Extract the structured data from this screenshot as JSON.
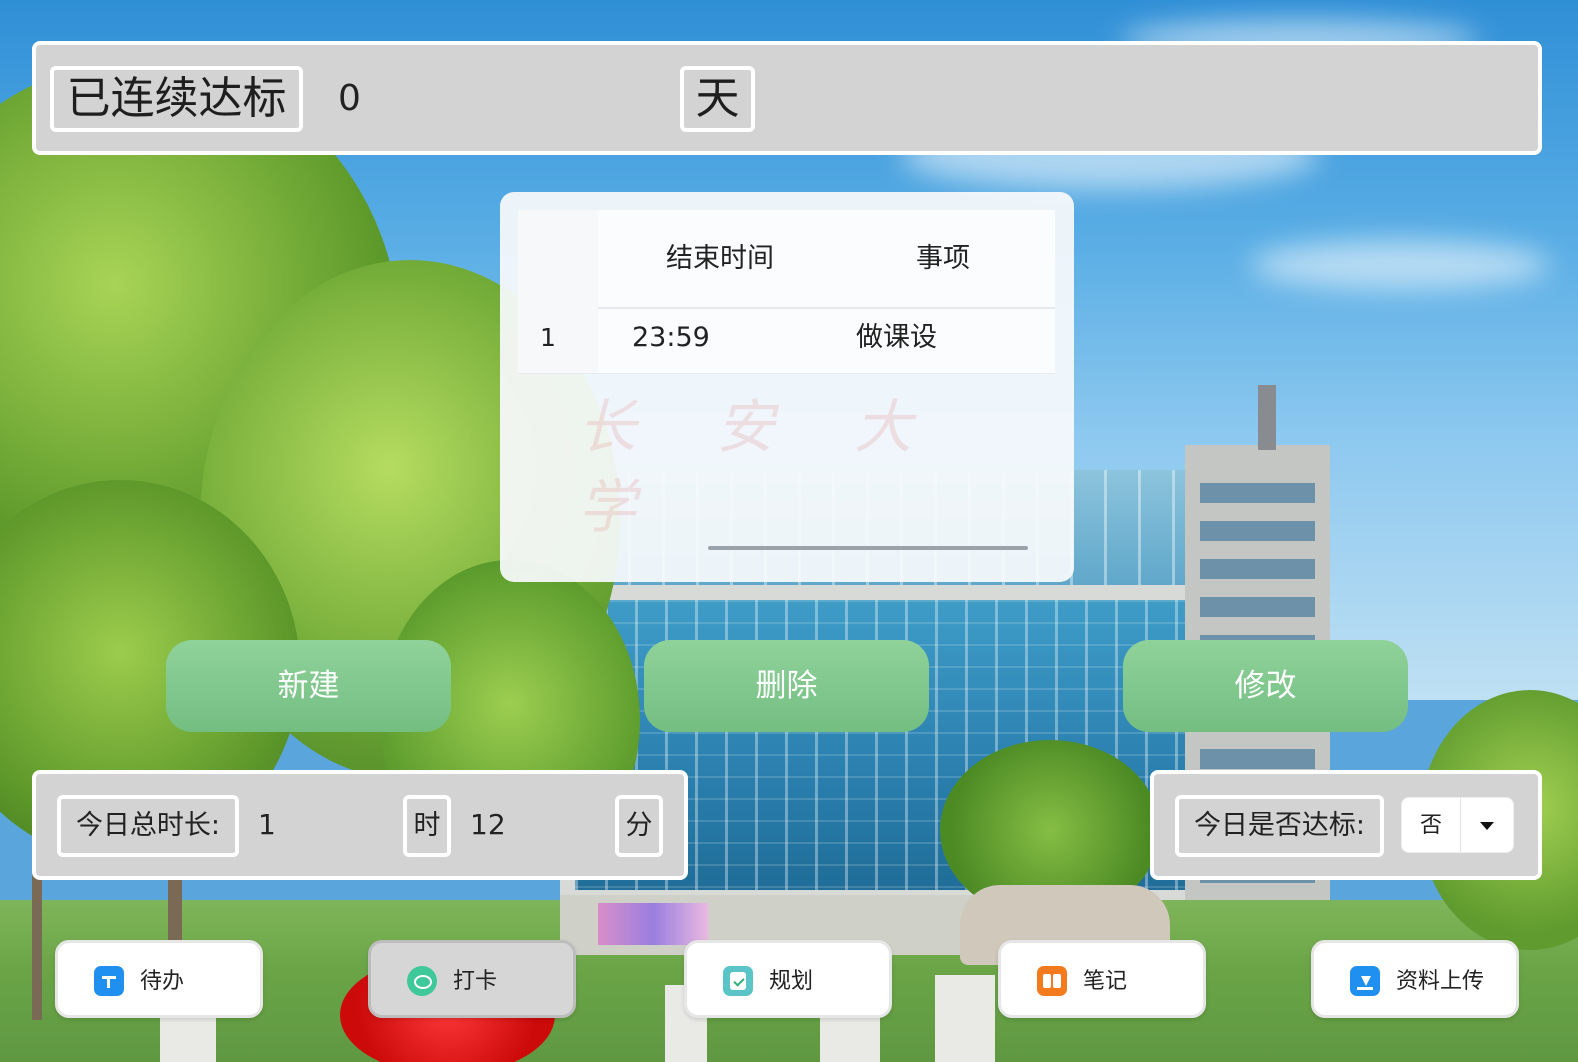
{
  "header": {
    "streak_label": "已连续达标",
    "streak_value": "0",
    "streak_unit": "天"
  },
  "task_table": {
    "columns": [
      "",
      "结束时间",
      "事项"
    ],
    "rows": [
      {
        "index": "1",
        "end_time": "23:59",
        "item": "做课设"
      }
    ]
  },
  "background": {
    "watermark_text": "长安大学"
  },
  "actions": {
    "new_label": "新建",
    "delete_label": "删除",
    "edit_label": "修改"
  },
  "duration": {
    "label": "今日总时长:",
    "hours": "1",
    "hour_unit": "时",
    "minutes": "12",
    "minute_unit": "分"
  },
  "goal": {
    "label": "今日是否达标:",
    "selected": "否"
  },
  "nav": [
    {
      "label": "待办",
      "icon": "todo-icon",
      "active": false
    },
    {
      "label": "打卡",
      "icon": "checkin-icon",
      "active": true
    },
    {
      "label": "规划",
      "icon": "plan-icon",
      "active": false
    },
    {
      "label": "笔记",
      "icon": "notes-icon",
      "active": false
    },
    {
      "label": "资料上传",
      "icon": "upload-icon",
      "active": false
    }
  ],
  "colors": {
    "action_button": "#7cc48a",
    "panel_bg": "#d3d3d3",
    "panel_border": "#ffffff"
  }
}
